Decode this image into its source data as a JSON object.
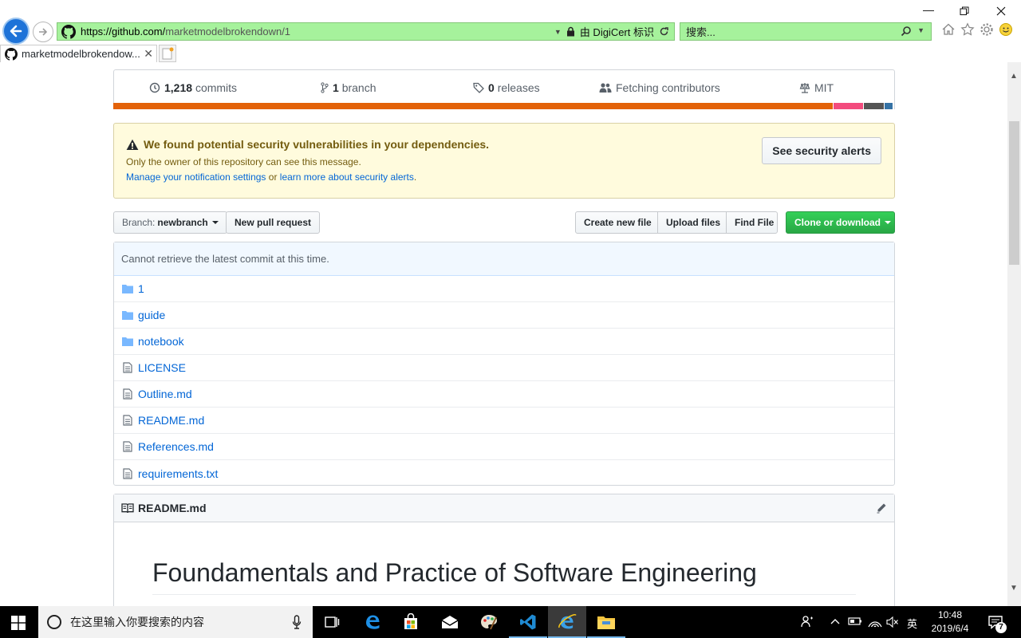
{
  "browser": {
    "url_main": "https://github.com/",
    "url_path": "marketmodelbrokendown/1",
    "security_label": "由 DigiCert 标识",
    "search_placeholder": "搜索...",
    "tab_title": "marketmodelbrokendow..."
  },
  "repo": {
    "summary": {
      "commits_count": "1,218",
      "commits_label": "commits",
      "branch_count": "1",
      "branch_label": "branch",
      "releases_count": "0",
      "releases_label": "releases",
      "contributors_label": "Fetching contributors",
      "license_label": "MIT"
    },
    "language_colors": [
      "#e36209",
      "#f34b7d",
      "#555555",
      "#3572a5"
    ],
    "alert": {
      "title": "We found potential security vulnerabilities in your dependencies.",
      "owner_note": "Only the owner of this repository can see this message.",
      "link_manage": "Manage your notification settings",
      "or_text": " or ",
      "link_learn": "learn more about security alerts",
      "period": ".",
      "button": "See security alerts"
    },
    "toolbar": {
      "branch_prefix": "Branch:",
      "branch_name": "newbranch",
      "new_pull_request": "New pull request",
      "create_new_file": "Create new file",
      "upload_files": "Upload files",
      "find_file": "Find File",
      "clone_or_download": "Clone or download"
    },
    "commit_message": "Cannot retrieve the latest commit at this time.",
    "files": [
      {
        "name": "1",
        "type": "folder"
      },
      {
        "name": "guide",
        "type": "folder"
      },
      {
        "name": "notebook",
        "type": "folder"
      },
      {
        "name": "LICENSE",
        "type": "file"
      },
      {
        "name": "Outline.md",
        "type": "file"
      },
      {
        "name": "README.md",
        "type": "file"
      },
      {
        "name": "References.md",
        "type": "file"
      },
      {
        "name": "requirements.txt",
        "type": "file"
      }
    ],
    "readme": {
      "header": "README.md",
      "heading": "Foundamentals and Practice of Software Engineering"
    }
  },
  "taskbar": {
    "search_placeholder": "在这里输入你要搜索的内容",
    "ime_label": "英",
    "time": "10:48",
    "date": "2019/6/4",
    "notification_count": "7"
  }
}
